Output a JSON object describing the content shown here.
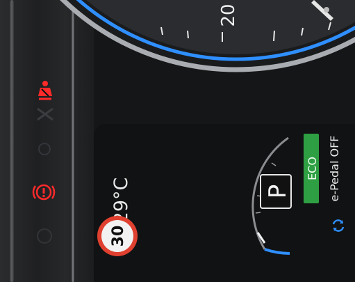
{
  "cluster": {
    "speedometer": {
      "visible_number": "20"
    },
    "telltales": {
      "seatbelt_warning_icon": "seatbelt-warning-icon",
      "parking_brake_icon": "parking-brake-warning-icon",
      "active_color": "#ff2a2a"
    }
  },
  "display": {
    "temperature": "29°C",
    "speed_limit": "30",
    "gear": "P",
    "drive_mode": "ECO",
    "epedal_status": "e-Pedal OFF",
    "colors": {
      "eco_badge": "#2ea043",
      "arc_blue": "#2f8fff",
      "limit_ring": "#e0402f"
    }
  }
}
